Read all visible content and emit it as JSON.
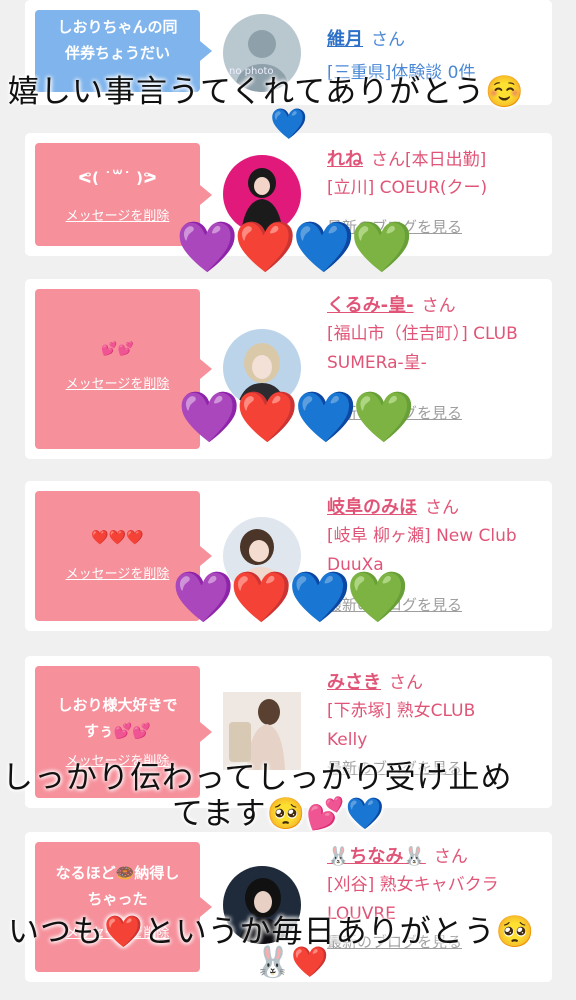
{
  "cards": [
    {
      "message": "しおりちゃんの同伴券ちょうだい",
      "name": "維月",
      "san": "さん",
      "shop": "[三重県]体験談 0件",
      "delete_label": "",
      "blog_label": "",
      "bubble_color": "#7fb4ec",
      "avatar_text": "no photo"
    },
    {
      "message": "ᕙ( ˙꒳˙ )ᕗ",
      "name": "れね",
      "san": "さん[本日出勤]",
      "shop": "[立川] COEUR(クー)",
      "delete_label": "メッセージを削除",
      "blog_label": "最新のブログを見る",
      "bubble_color": "#f6909b"
    },
    {
      "message": "💕💕",
      "name": "くるみ-皇-",
      "san": "さん",
      "shop": "[福山市（住吉町）] CLUB SUMERa-皇-",
      "delete_label": "メッセージを削除",
      "blog_label": "最新のブログを見る",
      "bubble_color": "#f6909b"
    },
    {
      "message": "❤️❤️❤️",
      "name": "岐阜のみほ",
      "san": "さん",
      "shop": "[岐阜 柳ヶ瀬] New Club DuuXa",
      "delete_label": "メッセージを削除",
      "blog_label": "最新のブログを見る",
      "bubble_color": "#f6909b"
    },
    {
      "message": "しおり様大好きですぅ💕💕",
      "name": "みさき",
      "san": "さん",
      "shop": "[下赤塚] 熟女CLUB Kelly",
      "delete_label": "メッセージを削除",
      "blog_label": "最新のブログを見る",
      "bubble_color": "#f6909b"
    },
    {
      "message": "なるほど🍩納得しちゃった",
      "name": "🐰ちなみ🐰",
      "san": "さん",
      "shop": "[刈谷] 熟女キャバクラ LOUVRE",
      "delete_label": "メッセージを削除",
      "blog_label": "最新のブログを見る",
      "bubble_color": "#f6909b"
    }
  ],
  "overlays": {
    "line1": "嬉しい事言うてくれてありがとう☺️",
    "line2a": "しっかり伝わってしっかり受け止め",
    "line2b": "てます🥺💕💙",
    "line3": "いつも❤️というか毎日ありがとう🥺",
    "line3b": "🐰❤️"
  },
  "hearts": {
    "blue_single": "💙",
    "row": "💜❤️💙💚"
  }
}
